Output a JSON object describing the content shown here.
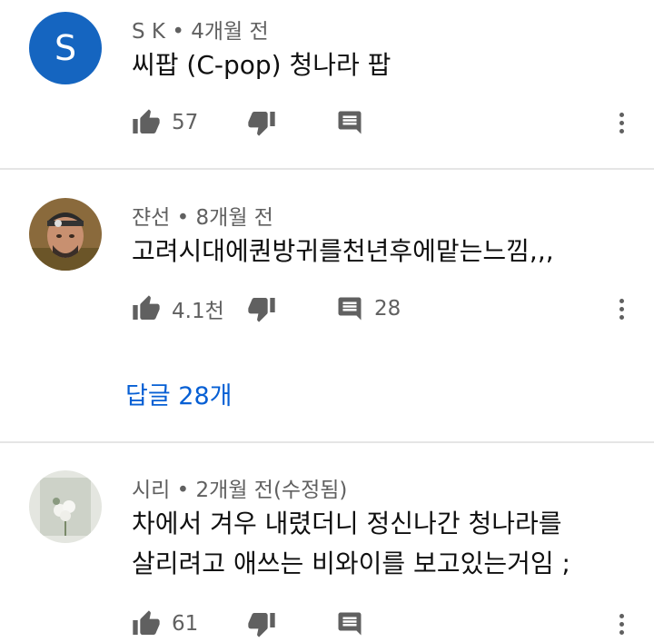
{
  "comments": [
    {
      "author": "S K",
      "time": "4개월 전",
      "avatar_letter": "S",
      "lines": [
        "씨팝 (C-pop) 청나라 팝"
      ],
      "likes": "57",
      "replies_count": ""
    },
    {
      "author": "쟌선",
      "time": "8개월 전",
      "lines": [
        "고려시대에퀀방귀를천년후에맡는느낌,,,"
      ],
      "likes": "4.1천",
      "replies_count": "28",
      "replies_link": "답글 28개"
    },
    {
      "author": "시리",
      "time": "2개월 전(수정됨)",
      "lines": [
        "차에서 겨우 내렸더니 정신나간 청나라를",
        "살리려고 애쓰는 비와이를 보고있는거임 ;"
      ],
      "likes": "61",
      "replies_count": ""
    }
  ],
  "separator": "•",
  "icons": [
    "thumbs-up-icon",
    "thumbs-down-icon",
    "reply-icon",
    "more-icon"
  ],
  "colors": {
    "avatar_bg": "#1565c0",
    "link": "#065fd4",
    "meta": "#606060"
  }
}
